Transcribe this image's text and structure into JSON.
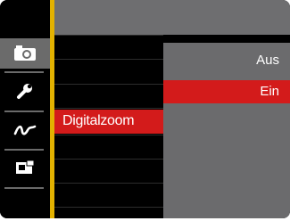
{
  "sidebar": {
    "items": [
      {
        "icon": "camera-icon",
        "active": true
      },
      {
        "icon": "wrench-icon",
        "active": false
      },
      {
        "icon": "signature-icon",
        "active": false
      },
      {
        "icon": "playback-settings-icon",
        "active": false
      }
    ]
  },
  "menu": {
    "selected_item": "Digitalzoom"
  },
  "options": {
    "items": [
      "Aus",
      "Ein"
    ],
    "selected": "Ein"
  },
  "colors": {
    "highlight": "#d31b1b",
    "accent_bar": "#e3b200",
    "panel": "#6b6b6d"
  }
}
